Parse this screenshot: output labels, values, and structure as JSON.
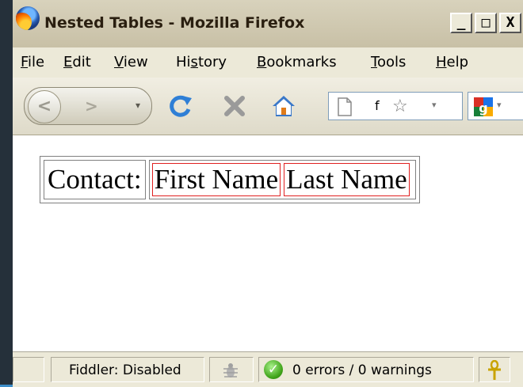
{
  "window": {
    "title": "Nested Tables - Mozilla Firefox",
    "caption_buttons": [
      "_",
      "□",
      "X"
    ]
  },
  "menu": {
    "items": [
      {
        "label": "File",
        "mnemonic": "F"
      },
      {
        "label": "Edit",
        "mnemonic": "E"
      },
      {
        "label": "View",
        "mnemonic": "V"
      },
      {
        "label": "History",
        "mnemonic": "s"
      },
      {
        "label": "Bookmarks",
        "mnemonic": "B"
      },
      {
        "label": "Tools",
        "mnemonic": "T"
      },
      {
        "label": "Help",
        "mnemonic": "H"
      }
    ]
  },
  "toolbar": {
    "back_icon": "back-arrow-icon",
    "forward_icon": "forward-arrow-icon",
    "reload_icon": "reload-icon",
    "stop_icon": "stop-icon",
    "home_icon": "home-icon",
    "url_text": "f",
    "search_engine_icon": "google-icon"
  },
  "content": {
    "contact_label": "Contact:",
    "first_name": "First Name",
    "last_name": "Last Name"
  },
  "status": {
    "fiddler": "Fiddler: Disabled",
    "errors": "0 errors / 0 warnings"
  },
  "colors": {
    "inner_border": "#e02020",
    "outer_border": "#808080",
    "window_face": "#ece9d8"
  }
}
